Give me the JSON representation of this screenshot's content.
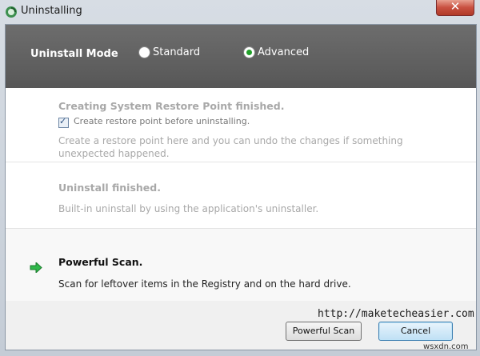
{
  "window": {
    "title": "Uninstalling"
  },
  "mode": {
    "label": "Uninstall Mode",
    "options": [
      {
        "label": "Standard",
        "selected": false
      },
      {
        "label": "Advanced",
        "selected": true
      }
    ]
  },
  "steps": [
    {
      "title": "Creating System Restore Point finished.",
      "checkbox_label": "Create restore point before uninstalling.",
      "checkbox_checked": true,
      "description": "Create a restore point here and you can undo the changes if something unexpected happened."
    },
    {
      "title": "Uninstall finished.",
      "description": "Built-in uninstall by using the application's uninstaller."
    },
    {
      "title": "Powerful Scan.",
      "description": "Scan for leftover items in the Registry and on the hard drive.",
      "active": true
    }
  ],
  "buttons": {
    "powerful_scan": "Powerful Scan",
    "cancel": "Cancel"
  },
  "watermark": "http://maketecheasier.com",
  "corner_watermark": "wsxdn.com",
  "colors": {
    "active_arrow": "#2fb84a",
    "mode_bar": "#616161",
    "radio_selected": "#22a02a"
  }
}
